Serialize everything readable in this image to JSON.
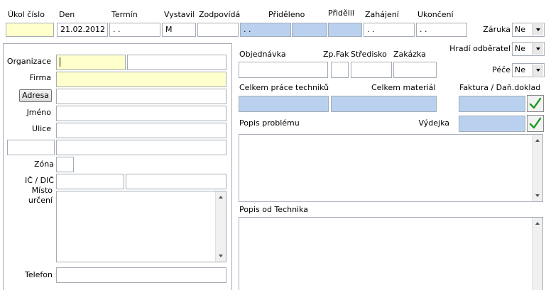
{
  "header": {
    "ukol_cislo": "Úkol číslo",
    "den": "Den",
    "termin": "Termín",
    "vystavil": "Vystavil",
    "zodpovida": "Zodpovídá",
    "prideleno": "Přiděleno",
    "pridelil": "Přidělil",
    "zahajeni": "Zahájení",
    "ukonceni": "Ukončení"
  },
  "values": {
    "ukol_cislo": "",
    "den": "21.02.2012",
    "termin": ". .",
    "vystavil": "M",
    "zodpovida": "",
    "prideleno": ". .",
    "zahajeni": ". .",
    "ukonceni": ". ."
  },
  "right": {
    "zaruka_label": "Záruka",
    "zaruka_value": "Ne",
    "hradi_label": "Hradí odběratel",
    "hradi_value": "Ne",
    "pece_label": "Péče",
    "pece_value": "Ne",
    "faktura_label": "Faktura / Daň.doklad",
    "vydejka_label": "Výdejka"
  },
  "left": {
    "organizace": "Organizace",
    "firma": "Firma",
    "adresa_button": "Adresa",
    "jmeno": "Jméno",
    "ulice": "Ulice",
    "zona": "Zóna",
    "ic_dic": "IČ / DIČ",
    "misto_line1": "Místo",
    "misto_line2": "určení",
    "telefon": "Telefon"
  },
  "middle": {
    "objednavka": "Objednávka",
    "zp_fak": "Zp.Fak",
    "stredisko": "Středisko",
    "zakazka": "Zakázka",
    "celkem_prace": "Celkem práce techniků",
    "celkem_material": "Celkem materiál",
    "popis_problemu": "Popis problému",
    "popis_od_technika": "Popis od Technika"
  },
  "colors": {
    "yellow_field": "#ffffcc",
    "blue_field": "#b9d1ef",
    "check_green": "#1a9a1a"
  }
}
